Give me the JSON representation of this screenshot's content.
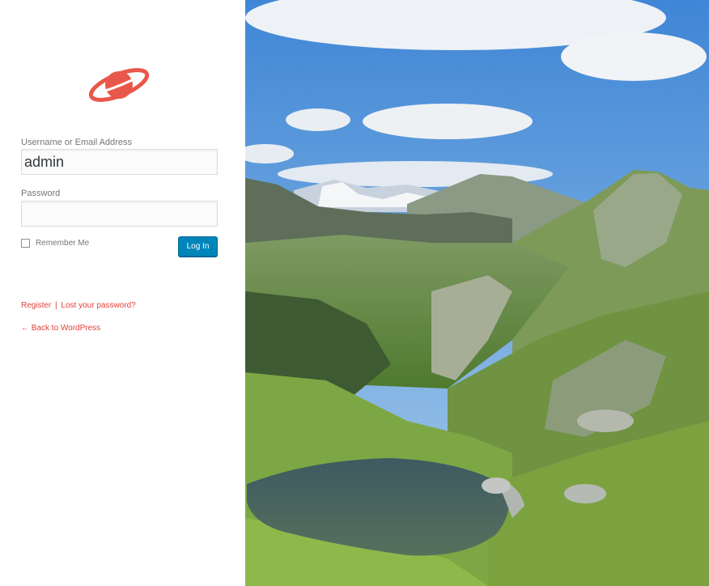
{
  "login": {
    "username_label": "Username or Email Address",
    "username_value": "admin",
    "password_label": "Password",
    "password_value": "",
    "remember_label": "Remember Me",
    "remember_checked": false,
    "submit_label": "Log In",
    "register_link": "Register",
    "separator": "|",
    "lost_password_link": "Lost your password?",
    "back_link": "← Back to WordPress"
  },
  "colors": {
    "accent": "#e2403b",
    "button": "#0085ba",
    "logo": "#e8584a"
  },
  "icons": {
    "logo": "planet-icon"
  }
}
